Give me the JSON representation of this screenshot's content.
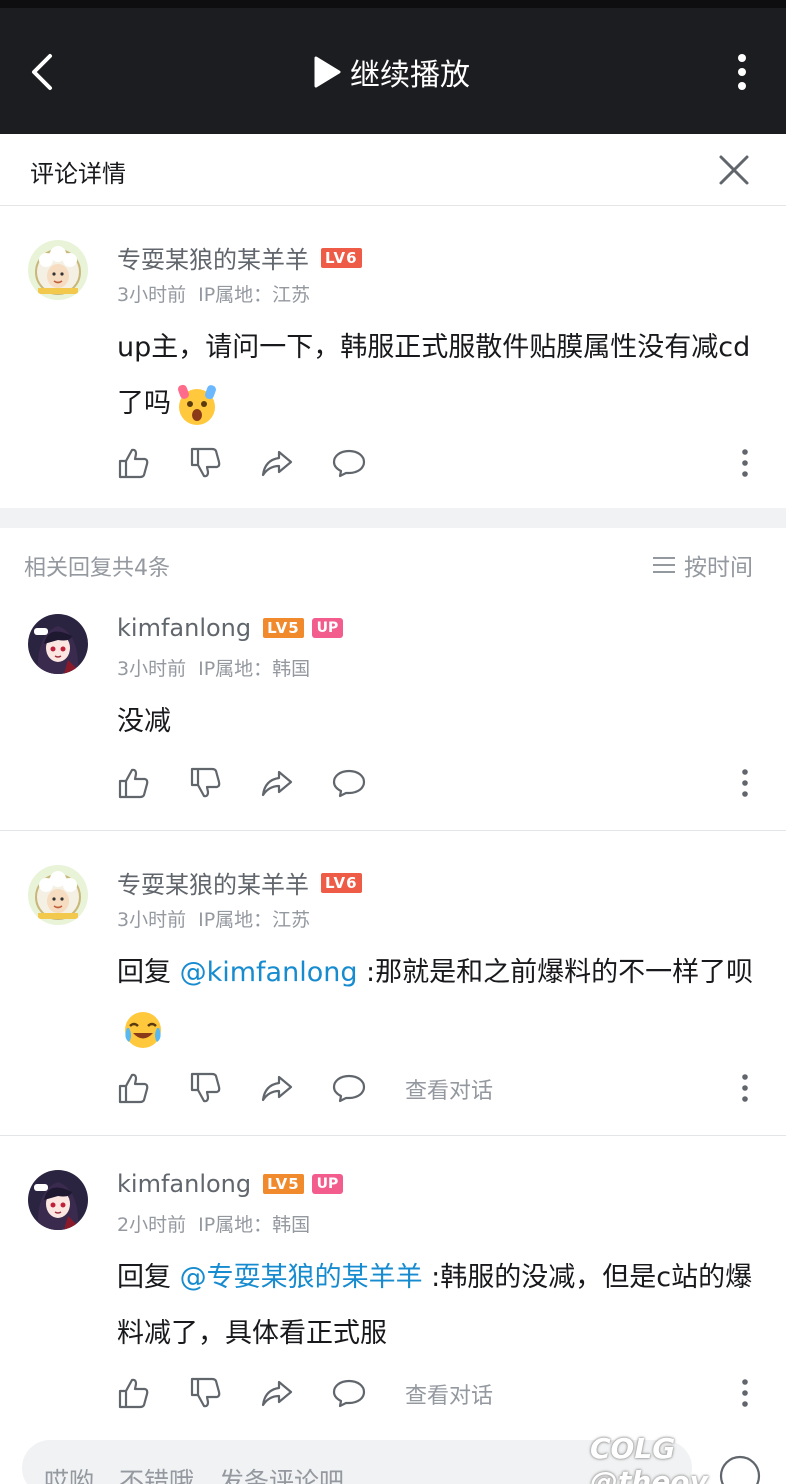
{
  "topbar": {
    "play_label": "继续播放"
  },
  "detail": {
    "title": "评论详情"
  },
  "main_comment": {
    "username": "专耍某狼的某羊羊",
    "level": "LV6",
    "time": "3小时前",
    "ip": "IP属地：江苏",
    "text": "up主，请问一下，韩服正式服散件贴膜属性没有减cd了吗"
  },
  "replies_header": {
    "count_label": "相关回复共4条",
    "sort_label": "按时间"
  },
  "replies": [
    {
      "username": "kimfanlong",
      "level": "LV5",
      "badge": "UP",
      "time": "3小时前",
      "ip": "IP属地：韩国",
      "text": "没减"
    },
    {
      "username": "专耍某狼的某羊羊",
      "level": "LV6",
      "time": "3小时前",
      "ip": "IP属地：江苏",
      "prefix": "回复 ",
      "mention": "@kimfanlong",
      "text": " :那就是和之前爆料的不一样了呗",
      "view_label": "查看对话"
    },
    {
      "username": "kimfanlong",
      "level": "LV5",
      "badge": "UP",
      "time": "2小时前",
      "ip": "IP属地：韩国",
      "prefix": "回复 ",
      "mention": "@专耍某狼的某羊羊",
      "text": " :韩服的没减，但是c站的爆料减了，具体看正式服",
      "view_label": "查看对话"
    }
  ],
  "bottom": {
    "placeholder": "哎哟，不错哦，发条评论吧"
  },
  "watermark": "COLG @theoy",
  "colors": {
    "topbar": "#1c1d21",
    "mention": "#178bcf",
    "lv6": "#ee5c47",
    "lv5": "#f08a2c",
    "up_badge": "#f25d8e"
  }
}
